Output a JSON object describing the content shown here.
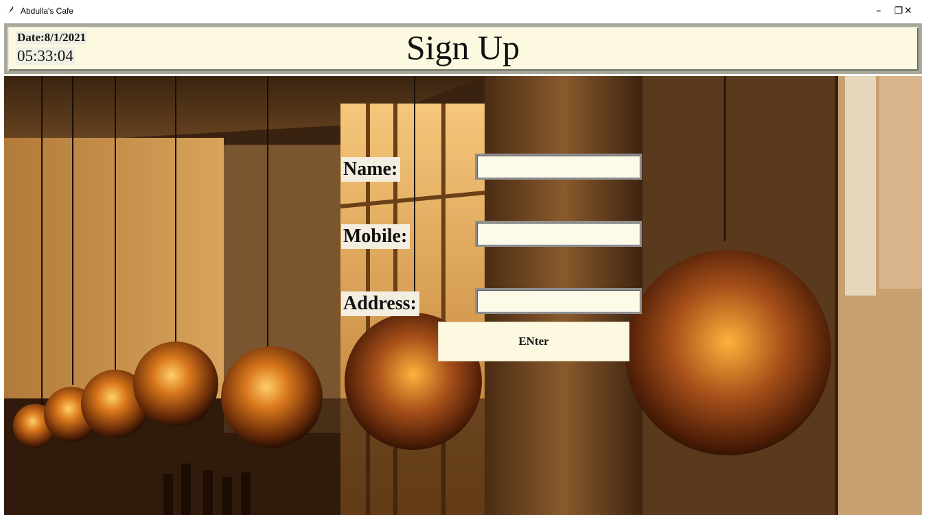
{
  "window": {
    "title": "Abdulla's Cafe",
    "icon": "feather-icon",
    "controls": {
      "minimize": "–",
      "maximize": "❐",
      "close": "✕"
    }
  },
  "header": {
    "date": "Date:8/1/2021",
    "time": "05:33:04",
    "title": "Sign Up"
  },
  "form": {
    "name_label": "Name:",
    "name_value": "",
    "mobile_label": "Mobile:",
    "mobile_value": "",
    "address_label": "Address:",
    "address_value": "",
    "submit_label": "ENter"
  },
  "background": {
    "description_icon": "cafe-interior-image",
    "colors": {
      "header_bg": "#fdf9e0",
      "scene_dark": "#2a1608",
      "lamp_glow": "#e08a1e"
    }
  }
}
